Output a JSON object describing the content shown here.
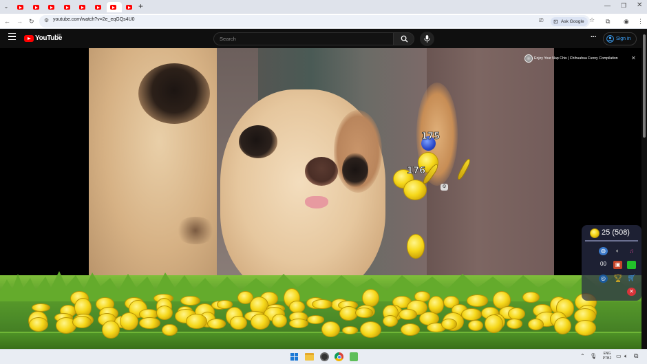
{
  "browser": {
    "tab_count": 8,
    "url": "youtube.com/watch?v=2e_eqGQs4U0",
    "ask_google": "Ask Google",
    "new_tab_symbol": "+"
  },
  "youtube": {
    "logo_text": "YouTube",
    "country_code": "BR",
    "search_placeholder": "Search",
    "sign_in": "Sign in",
    "video_title": "Enjoy Your Nap Chis | Chihuahua Funny Compilation"
  },
  "game": {
    "floating_score_1": "175",
    "floating_score_2": "176",
    "coin_count": "25 (508)",
    "counter_label": "00"
  },
  "taskbar": {
    "language": "ENG",
    "keyboard": "PTB2"
  },
  "colors": {
    "youtube_red": "#ff0000",
    "signin_blue": "#3ea6ff",
    "coin_gold": "#f6d81a",
    "grass_green": "#5a9c2a"
  }
}
